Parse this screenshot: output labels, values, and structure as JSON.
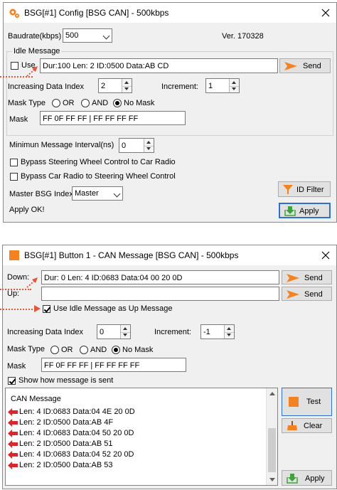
{
  "window1": {
    "title": "BSG[#1] Config [BSG CAN] - 500kbps",
    "baudrate_label": "Baudrate(kbps)",
    "baudrate_value": "500",
    "version": "Ver. 170328",
    "idle_group_label": "Idle Message",
    "use_label": "Use",
    "idle_message": "Dur:100 Len: 2 ID:0500 Data:AB CD",
    "send_label": "Send",
    "inc_index_label": "Increasing Data Index",
    "inc_index_value": "2",
    "increment_label": "Increment:",
    "increment_value": "1",
    "mask_type_label": "Mask Type",
    "mask_or": "OR",
    "mask_and": "AND",
    "mask_none": "No Mask",
    "mask_label": "Mask",
    "mask_value": "FF 0F FF FF | FF FF FF FF",
    "min_interval_label": "Minimun Message Interval(ns)",
    "min_interval_value": "0",
    "bypass1": "Bypass Steering Wheel Control to Car Radio",
    "bypass2": "Bypass Car Radio to Steering Wheel Control",
    "master_label": "Master BSG Index",
    "master_value": "Master",
    "id_filter_label": "ID Filter",
    "status": "Apply OK!",
    "apply_label": "Apply"
  },
  "window2": {
    "title": "BSG[#1] Button 1 - CAN Message [BSG CAN] - 500kbps",
    "down_label": "Down:",
    "down_value": "Dur:  0 Len: 4 ID:0683 Data:04 00 20 0D",
    "up_label": "Up:",
    "up_value": "",
    "send_label": "Send",
    "use_idle_label": "Use Idle Message as Up Message",
    "inc_index_label": "Increasing Data Index",
    "inc_index_value": "0",
    "increment_label": "Increment:",
    "increment_value": "-1",
    "mask_type_label": "Mask Type",
    "mask_or": "OR",
    "mask_and": "AND",
    "mask_none": "No Mask",
    "mask_label": "Mask",
    "mask_value": "FF 0F FF FF | FF FF FF FF",
    "show_label": "Show how message is sent",
    "list_header": "CAN Message",
    "messages": [
      "Len: 4 ID:0683 Data:04 4E 20 0D",
      "Len: 2 ID:0500 Data:AB 4F",
      "Len: 4 ID:0683 Data:04 50 20 0D",
      "Len: 2 ID:0500 Data:AB 51",
      "Len: 4 ID:0683 Data:04 52 20 0D",
      "Len: 2 ID:0500 Data:AB 53"
    ],
    "test_label": "Test",
    "clear_label": "Clear",
    "apply_label": "Apply"
  },
  "colors": {
    "accent_orange": "#f58220",
    "arrow_red": "#d7282f",
    "dotted": "#e0573a",
    "apply_border": "#2f6fd0",
    "apply_green": "#3aa53a"
  }
}
